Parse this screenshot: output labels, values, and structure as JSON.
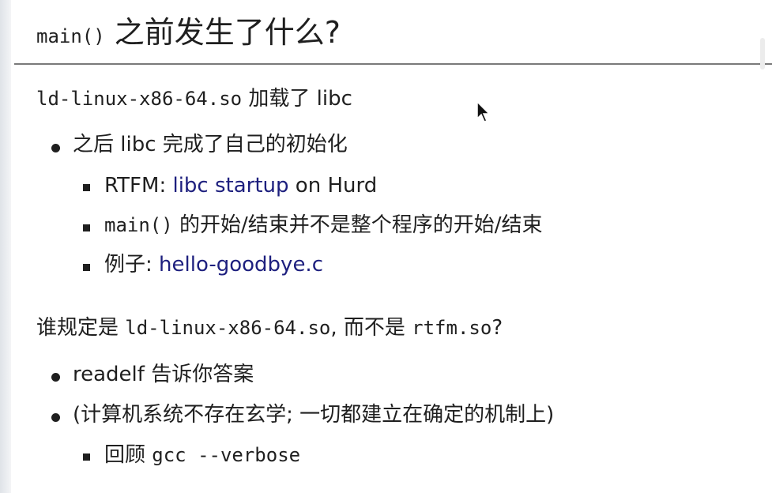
{
  "slide": {
    "title": {
      "code": "main()",
      "text": " 之前发生了什么?"
    },
    "intro": {
      "code": "ld-linux-x86-64.so",
      "text": " 加载了 libc"
    },
    "bullet1": "之后 libc 完成了自己的初始化",
    "sub1": {
      "prefix": "RTFM: ",
      "link": "libc startup",
      "suffix": " on Hurd"
    },
    "sub2": {
      "code": "main()",
      "text": " 的开始/结束并不是整个程序的开始/结束"
    },
    "sub3": {
      "prefix": "例子:  ",
      "link": "hello-goodbye.c"
    },
    "question": {
      "p1": "谁规定是 ",
      "c1": "ld-linux-x86-64.so",
      "p2": ", 而不是 ",
      "c2": "rtfm.so",
      "p3": "?"
    },
    "bullet2": "readelf 告诉你答案",
    "bullet3": "(计算机系统不存在玄学; 一切都建立在确定的机制上)",
    "sub4": {
      "prefix": "回顾 ",
      "code": "gcc --verbose"
    }
  },
  "colors": {
    "link": "#1d1f7e",
    "text": "#1f1f1f",
    "rule": "#7a7a7a"
  },
  "icons": {
    "cursor": "mouse-pointer-icon",
    "bullet": "disc-bullet",
    "sub_bullet": "square-bullet"
  }
}
